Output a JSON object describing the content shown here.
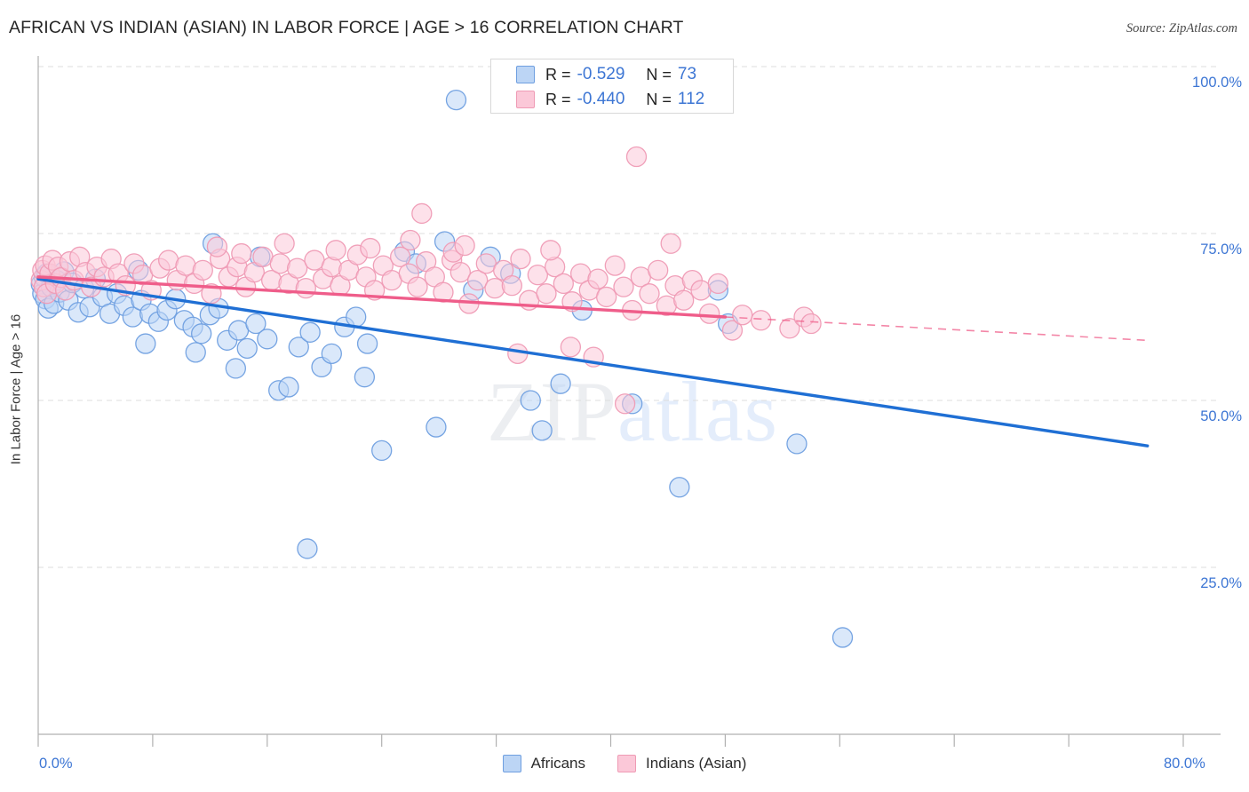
{
  "header": {
    "title": "AFRICAN VS INDIAN (ASIAN) IN LABOR FORCE | AGE > 16 CORRELATION CHART",
    "source": "Source: ZipAtlas.com"
  },
  "watermark": {
    "part1": "ZIP",
    "part2": "atlas"
  },
  "stats": {
    "rows": [
      {
        "r_label": "R =",
        "r_value": "-0.529",
        "n_label": "N =",
        "n_value": "73",
        "color": "#bcd5f5"
      },
      {
        "r_label": "R =",
        "r_value": "-0.440",
        "n_label": "N =",
        "n_value": "112",
        "color": "#fbc8d8"
      }
    ]
  },
  "legend": {
    "items": [
      {
        "label": "Africans",
        "color": "#bcd5f5"
      },
      {
        "label": "Indians (Asian)",
        "color": "#fbc8d8"
      }
    ]
  },
  "chart_data": {
    "type": "scatter",
    "title": "AFRICAN VS INDIAN (ASIAN) IN LABOR FORCE | AGE > 16 CORRELATION CHART",
    "xlabel": "",
    "ylabel": "In Labor Force | Age > 16",
    "xlim": [
      0,
      80
    ],
    "ylim": [
      0,
      106
    ],
    "xticks": [
      "0.0%",
      "80.0%"
    ],
    "yticks": [
      "25.0%",
      "50.0%",
      "75.0%",
      "100.0%"
    ],
    "ytick_values": [
      25,
      50,
      75,
      100
    ],
    "grid": true,
    "legend_position": "bottom",
    "accent_blue": "#1f6fd4",
    "accent_pink": "#ef5d8a",
    "series": [
      {
        "name": "Africans",
        "color": "#bcd5f5",
        "edge": "#6f9fe0",
        "r": -0.529,
        "n": 73,
        "trend": {
          "x0": 0,
          "y0": 68.2,
          "x1": 77.5,
          "y1": 43.2,
          "style": "solid"
        },
        "points": [
          [
            0.2,
            67.4
          ],
          [
            0.3,
            66.0
          ],
          [
            0.4,
            68.5
          ],
          [
            0.5,
            65.2
          ],
          [
            0.6,
            69.0
          ],
          [
            0.7,
            63.8
          ],
          [
            0.9,
            67.0
          ],
          [
            1.1,
            64.5
          ],
          [
            1.3,
            68.0
          ],
          [
            1.5,
            66.2
          ],
          [
            1.8,
            69.3
          ],
          [
            2.1,
            65.0
          ],
          [
            2.4,
            67.6
          ],
          [
            2.8,
            63.2
          ],
          [
            3.2,
            66.8
          ],
          [
            3.6,
            64.0
          ],
          [
            4.0,
            68.2
          ],
          [
            4.5,
            65.5
          ],
          [
            5.0,
            63.0
          ],
          [
            5.5,
            66.0
          ],
          [
            6.0,
            64.2
          ],
          [
            6.6,
            62.5
          ],
          [
            7.2,
            65.0
          ],
          [
            7.8,
            63.0
          ],
          [
            8.4,
            61.8
          ],
          [
            7.0,
            69.5
          ],
          [
            9.0,
            63.5
          ],
          [
            7.5,
            58.5
          ],
          [
            10.2,
            62.0
          ],
          [
            10.8,
            61.0
          ],
          [
            9.6,
            65.2
          ],
          [
            11.4,
            60.0
          ],
          [
            12.0,
            62.8
          ],
          [
            11.0,
            57.2
          ],
          [
            12.6,
            63.8
          ],
          [
            13.2,
            59.0
          ],
          [
            12.2,
            73.5
          ],
          [
            14.0,
            60.5
          ],
          [
            14.6,
            57.8
          ],
          [
            15.2,
            61.5
          ],
          [
            13.8,
            54.8
          ],
          [
            16.0,
            59.2
          ],
          [
            16.8,
            51.5
          ],
          [
            17.5,
            52.0
          ],
          [
            15.5,
            71.5
          ],
          [
            18.2,
            58.0
          ],
          [
            19.0,
            60.2
          ],
          [
            19.8,
            55.0
          ],
          [
            20.5,
            57.0
          ],
          [
            18.8,
            27.8
          ],
          [
            21.4,
            61.0
          ],
          [
            22.2,
            62.5
          ],
          [
            23.0,
            58.5
          ],
          [
            24.0,
            42.5
          ],
          [
            22.8,
            53.5
          ],
          [
            25.6,
            72.3
          ],
          [
            26.4,
            70.5
          ],
          [
            27.8,
            46.0
          ],
          [
            28.4,
            73.8
          ],
          [
            29.2,
            95.0
          ],
          [
            30.4,
            66.5
          ],
          [
            31.6,
            71.5
          ],
          [
            33.0,
            69.0
          ],
          [
            34.4,
            50.0
          ],
          [
            35.2,
            45.5
          ],
          [
            36.5,
            52.5
          ],
          [
            38.0,
            63.5
          ],
          [
            41.5,
            49.5
          ],
          [
            44.8,
            37.0
          ],
          [
            47.5,
            66.5
          ],
          [
            48.2,
            61.5
          ],
          [
            53.0,
            43.5
          ],
          [
            56.2,
            14.5
          ]
        ]
      },
      {
        "name": "Indians (Asian)",
        "color": "#fbc8d8",
        "edge": "#ef9bb5",
        "r": -0.44,
        "n": 112,
        "trend": {
          "x0": 0,
          "y0": 68.5,
          "x1": 48.0,
          "y1": 62.5,
          "style": "solid",
          "dash_x1": 77.5,
          "dash_y1": 59.0
        },
        "points": [
          [
            0.2,
            68.0
          ],
          [
            0.3,
            69.5
          ],
          [
            0.4,
            67.0
          ],
          [
            0.5,
            70.2
          ],
          [
            0.6,
            66.0
          ],
          [
            0.8,
            69.0
          ],
          [
            1.0,
            71.0
          ],
          [
            1.2,
            67.5
          ],
          [
            1.4,
            70.0
          ],
          [
            1.6,
            68.4
          ],
          [
            1.9,
            66.5
          ],
          [
            2.2,
            70.8
          ],
          [
            2.5,
            68.0
          ],
          [
            2.9,
            71.5
          ],
          [
            3.3,
            69.2
          ],
          [
            3.7,
            67.0
          ],
          [
            4.1,
            70.0
          ],
          [
            4.6,
            68.5
          ],
          [
            5.1,
            71.2
          ],
          [
            5.6,
            69.0
          ],
          [
            6.1,
            67.2
          ],
          [
            6.7,
            70.5
          ],
          [
            7.3,
            68.8
          ],
          [
            7.9,
            66.5
          ],
          [
            8.5,
            69.8
          ],
          [
            9.1,
            71.0
          ],
          [
            9.7,
            68.0
          ],
          [
            10.3,
            70.2
          ],
          [
            10.9,
            67.5
          ],
          [
            11.5,
            69.5
          ],
          [
            12.1,
            66.0
          ],
          [
            12.7,
            71.2
          ],
          [
            13.3,
            68.5
          ],
          [
            13.9,
            70.0
          ],
          [
            14.5,
            67.0
          ],
          [
            15.1,
            69.2
          ],
          [
            15.7,
            71.5
          ],
          [
            16.3,
            68.0
          ],
          [
            16.9,
            70.5
          ],
          [
            17.5,
            67.5
          ],
          [
            18.1,
            69.8
          ],
          [
            18.7,
            66.8
          ],
          [
            19.3,
            71.0
          ],
          [
            19.9,
            68.2
          ],
          [
            20.5,
            70.0
          ],
          [
            21.1,
            67.2
          ],
          [
            21.7,
            69.5
          ],
          [
            22.3,
            71.8
          ],
          [
            22.9,
            68.5
          ],
          [
            23.5,
            66.5
          ],
          [
            24.1,
            70.2
          ],
          [
            24.7,
            68.0
          ],
          [
            25.3,
            71.5
          ],
          [
            25.9,
            69.0
          ],
          [
            26.5,
            67.0
          ],
          [
            27.1,
            70.8
          ],
          [
            27.7,
            68.5
          ],
          [
            28.3,
            66.2
          ],
          [
            28.9,
            71.0
          ],
          [
            29.5,
            69.2
          ],
          [
            30.1,
            64.5
          ],
          [
            30.7,
            68.0
          ],
          [
            31.3,
            70.5
          ],
          [
            31.9,
            66.8
          ],
          [
            32.5,
            69.5
          ],
          [
            33.1,
            67.2
          ],
          [
            33.7,
            71.2
          ],
          [
            34.3,
            65.0
          ],
          [
            34.9,
            68.8
          ],
          [
            35.5,
            66.0
          ],
          [
            36.1,
            70.0
          ],
          [
            36.7,
            67.5
          ],
          [
            37.3,
            64.8
          ],
          [
            37.9,
            69.0
          ],
          [
            38.5,
            66.5
          ],
          [
            39.1,
            68.2
          ],
          [
            39.7,
            65.5
          ],
          [
            40.3,
            70.2
          ],
          [
            40.9,
            67.0
          ],
          [
            41.5,
            63.5
          ],
          [
            42.1,
            68.5
          ],
          [
            42.7,
            66.0
          ],
          [
            43.3,
            69.5
          ],
          [
            43.9,
            64.2
          ],
          [
            44.5,
            67.2
          ],
          [
            45.1,
            65.0
          ],
          [
            45.7,
            68.0
          ],
          [
            46.3,
            66.5
          ],
          [
            46.9,
            63.0
          ],
          [
            47.5,
            67.5
          ],
          [
            12.5,
            73.0
          ],
          [
            14.2,
            72.0
          ],
          [
            17.2,
            73.5
          ],
          [
            20.8,
            72.5
          ],
          [
            23.2,
            72.8
          ],
          [
            26.0,
            74.0
          ],
          [
            29.0,
            72.2
          ],
          [
            29.8,
            73.2
          ],
          [
            26.8,
            78.0
          ],
          [
            35.8,
            72.5
          ],
          [
            41.8,
            86.5
          ],
          [
            44.2,
            73.5
          ],
          [
            33.5,
            57.0
          ],
          [
            38.8,
            56.5
          ],
          [
            41.0,
            49.5
          ],
          [
            37.2,
            58.0
          ],
          [
            48.5,
            60.5
          ],
          [
            50.5,
            62.0
          ],
          [
            52.5,
            60.8
          ],
          [
            53.5,
            62.5
          ],
          [
            49.2,
            62.8
          ],
          [
            54.0,
            61.5
          ]
        ]
      }
    ]
  },
  "axis_ticks": {
    "x": [
      {
        "label": "0.0%",
        "value": 0
      },
      {
        "label": "80.0%",
        "value": 80
      }
    ],
    "y": [
      {
        "label": "100.0%",
        "value": 100
      },
      {
        "label": "75.0%",
        "value": 75
      },
      {
        "label": "50.0%",
        "value": 50
      },
      {
        "label": "25.0%",
        "value": 25
      }
    ]
  }
}
